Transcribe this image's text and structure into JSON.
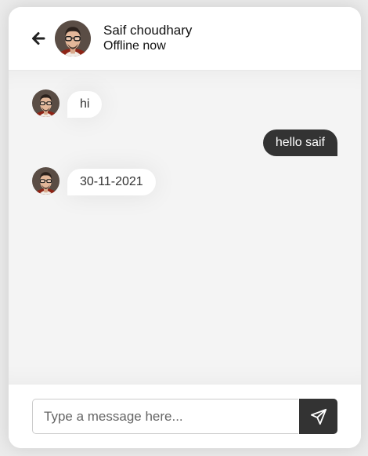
{
  "header": {
    "contact_name": "Saif choudhary",
    "status": "Offline now",
    "back_icon": "arrow-left-icon"
  },
  "messages": [
    {
      "direction": "incoming",
      "text": "hi"
    },
    {
      "direction": "outgoing",
      "text": "hello saif"
    },
    {
      "direction": "incoming",
      "text": "30-11-2021"
    }
  ],
  "composer": {
    "placeholder": "Type a message here...",
    "value": "",
    "send_icon": "paper-plane-icon"
  },
  "colors": {
    "page_background": "#ebebeb",
    "chat_background": "#f4f4f4",
    "outgoing_bubble": "#333333",
    "incoming_bubble": "#ffffff",
    "send_button": "#333333"
  }
}
